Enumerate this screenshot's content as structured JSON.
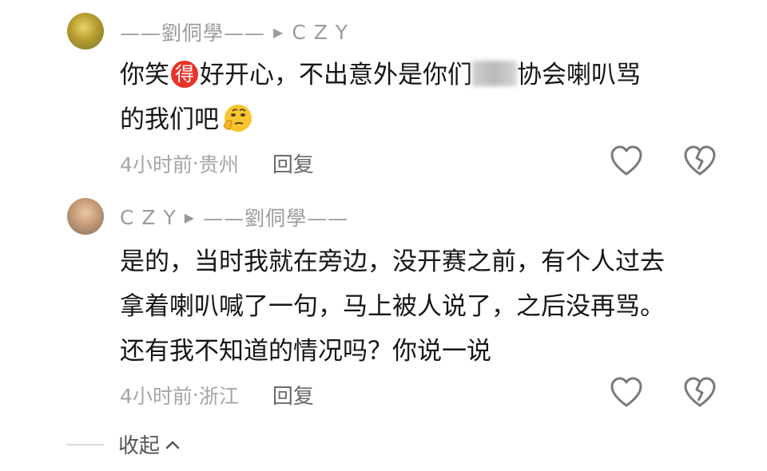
{
  "comments": [
    {
      "author": "——劉侗學——",
      "reply_to": "C Z Y",
      "text_line1_a": "你笑",
      "text_line1_badge": "得",
      "text_line1_b": "好开心，不出意外是你们",
      "text_line1_c": "协会喇叭骂",
      "text_line2": "的我们吧",
      "time": "4小时前",
      "location": "贵州",
      "reply_label": "回复"
    },
    {
      "author": "C Z Y",
      "reply_to": "——劉侗學——",
      "lines": [
        "是的，当时我就在旁边，没开赛之前，有个人过去",
        "拿着喇叭喊了一句，马上被人说了，之后没再骂。",
        "还有我不知道的情况吗？你说一说"
      ],
      "time": "4小时前",
      "location": "浙江",
      "reply_label": "回复"
    }
  ],
  "collapse_label": "收起",
  "separator": " · ",
  "icons": [
    "like-heart-icon",
    "dislike-broken-heart-icon",
    "thinking-emoji-icon",
    "chevron-up-icon",
    "reply-arrow-icon"
  ],
  "colors": {
    "meta": "#9b9b9b",
    "badge": "#e8332a",
    "text": "#161616"
  }
}
